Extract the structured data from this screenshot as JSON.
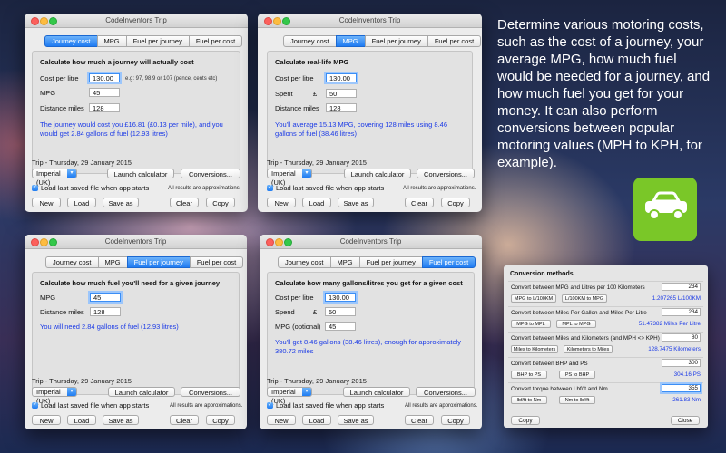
{
  "window_title": "CodeInventors Trip",
  "tabs": [
    "Journey cost",
    "MPG",
    "Fuel per journey",
    "Fuel per cost"
  ],
  "footer": {
    "trip": "Trip - Thursday, 29 January 2015",
    "unit_select": "Imperial (UK)",
    "launch_calculator": "Launch calculator",
    "conversions": "Conversions...",
    "load_last": "Load last saved file when app starts",
    "approx": "All results are approximations.",
    "new": "New",
    "load": "Load",
    "save_as": "Save as",
    "clear": "Clear",
    "copy": "Copy"
  },
  "w1": {
    "title": "Calculate how much a journey will actually cost",
    "cost_label": "Cost per litre",
    "cost_value": "130.00",
    "cost_hint": "e.g: 97, 98.9 or 107 (pence, cents etc)",
    "mpg_label": "MPG",
    "mpg_value": "45",
    "dist_label": "Distance miles",
    "dist_value": "128",
    "result": "The journey would cost you £16.81 (£0.13 per mile), and you would get 2.84 gallons of fuel (12.93 litres)"
  },
  "w2": {
    "title": "Calculate real-life MPG",
    "cost_label": "Cost per litre",
    "cost_value": "130.00",
    "spent_label": "Spent",
    "currency": "£",
    "spent_value": "50",
    "dist_label": "Distance miles",
    "dist_value": "128",
    "result": "You'll average 15.13 MPG, covering 128 miles using 8.46 gallons of fuel (38.46 litres)"
  },
  "w3": {
    "title": "Calculate how much fuel you'll need for a given journey",
    "mpg_label": "MPG",
    "mpg_value": "45",
    "dist_label": "Distance miles",
    "dist_value": "128",
    "result": "You will need 2.84 gallons of fuel (12.93 litres)"
  },
  "w4": {
    "title": "Calculate how many gallons/litres you get for a given cost",
    "cost_label": "Cost per litre",
    "cost_value": "130.00",
    "spend_label": "Spend",
    "currency": "£",
    "spend_value": "50",
    "mpg_label": "MPG (optional)",
    "mpg_value": "45",
    "result": "You'll get 8.46 gallons (38.46 litres), enough for approximately 380.72 miles"
  },
  "description": "Determine various motoring costs, such as the cost of a journey, your average MPG, how much fuel would be needed for a journey, and how much fuel you get for your money. It can also perform conversions between popular motoring values (MPH to KPH, for example).",
  "app_icon": "car-icon",
  "accent_color": "#1f7cf2",
  "icon_color": "#7ac728",
  "conversions": {
    "title": "Conversion methods",
    "sections": [
      {
        "title": "Convert between MPG and Litres per 100 Kilometers",
        "value": "234",
        "btn1": "MPG to L/100KM",
        "btn2": "L/100KM to MPG",
        "result": "1.207265 L/100KM"
      },
      {
        "title": "Convert between Miles Per Gallon and Miles Per Litre",
        "value": "234",
        "btn1": "MPG to MPL",
        "btn2": "MPL to MPG",
        "result": "51.47382 Miles Per Litre"
      },
      {
        "title": "Convert between Miles and Kilometers (and MPH <> KPH)",
        "value": "80",
        "btn1": "Miles to Kilometers",
        "btn2": "Kilometers to Miles",
        "result": "128.7475 Kilometers"
      },
      {
        "title": "Convert between BHP and PS",
        "value": "300",
        "btn1": "BHP to PS",
        "btn2": "PS to BHP",
        "result": "304.16 PS"
      },
      {
        "title": "Convert torque between Lbf/ft and Nm",
        "value": "355",
        "btn1": "lbf/ft to Nm",
        "btn2": "Nm to lbf/ft",
        "result": "261.83 Nm"
      }
    ],
    "copy": "Copy",
    "close": "Close"
  }
}
